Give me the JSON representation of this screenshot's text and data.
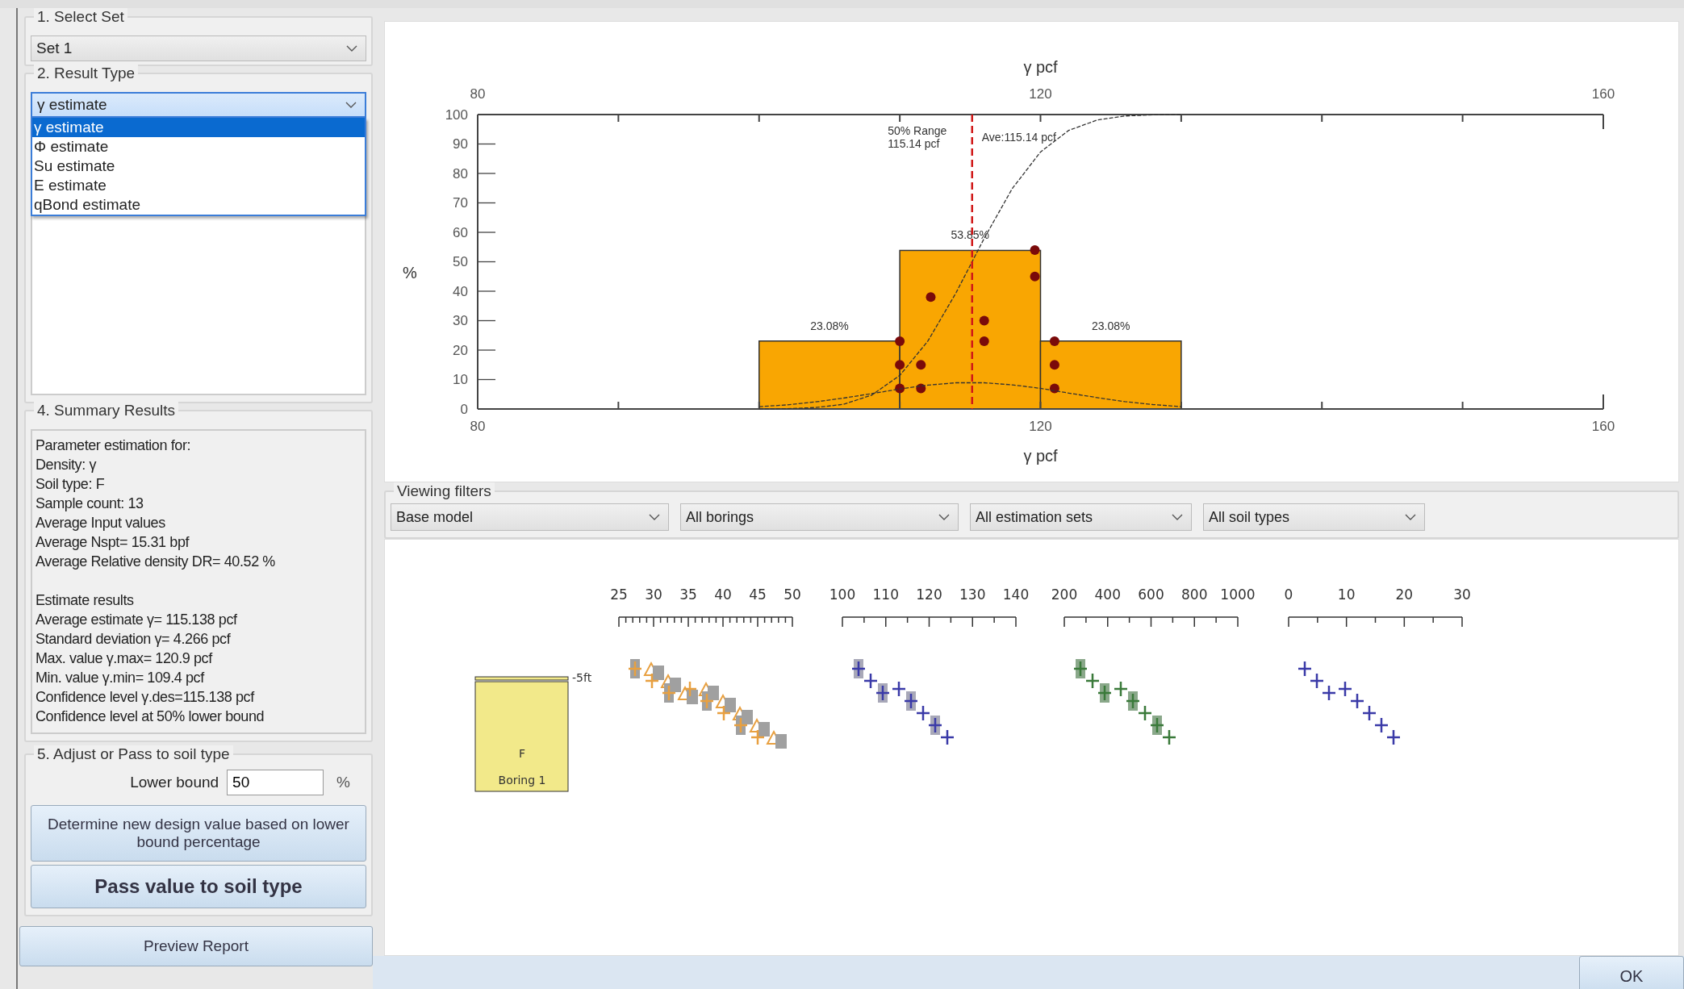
{
  "select_set": {
    "title": "1. Select Set",
    "value": "Set 1"
  },
  "result_type": {
    "title": "2. Result Type",
    "value": "γ estimate",
    "options": [
      {
        "label": "γ estimate",
        "selected": true
      },
      {
        "label": "Φ estimate",
        "selected": false
      },
      {
        "label": "Su estimate",
        "selected": false
      },
      {
        "label": "E estimate",
        "selected": false
      },
      {
        "label": "qBond estimate",
        "selected": false
      }
    ]
  },
  "summary": {
    "title": "4. Summary Results",
    "sections": [
      [
        "Parameter estimation for:",
        "Density: γ",
        "Soil type: F",
        "Sample count: 13",
        "Average Input values",
        "Average Nspt= 15.31 bpf",
        "Average Relative density DR= 40.52 %"
      ],
      [
        "Estimate results",
        "Average estimate γ= 115.138 pcf",
        "Standard deviation γ= 4.266 pcf",
        "Max. value γ.max= 120.9 pcf",
        "Min. value γ.min= 109.4 pcf",
        "Confidence level γ.des=115.138 pcf",
        "Confidence level at 50% lower bound"
      ]
    ]
  },
  "adjust": {
    "title": "5. Adjust or Pass to soil type",
    "lower_bound_label": "Lower bound",
    "lower_bound_value": "50",
    "unit": "%",
    "buttons": [
      {
        "label": "Determine new design value based on lower bound percentage",
        "kind": "normal"
      },
      {
        "label": "Pass value to soil type",
        "kind": "bold"
      }
    ]
  },
  "preview_button": "Preview Report",
  "chart": {
    "chart_data": {
      "type": "bar",
      "xlabel": "γ pcf",
      "ylabel": "%",
      "x": [
        105,
        115,
        125
      ],
      "series": [
        {
          "type": "bar",
          "color": "#f9a602",
          "values": [
            23.08,
            53.85,
            23.08
          ]
        },
        {
          "type": "scatter",
          "color": "#7a0a0a",
          "x": [
            110,
            110,
            110,
            111.5,
            111.5,
            112.2,
            116,
            116,
            119.6,
            119.6,
            121,
            121,
            121
          ],
          "values": [
            7,
            15,
            23,
            7,
            15,
            38,
            23,
            30,
            45,
            54,
            7,
            15,
            23
          ]
        },
        {
          "type": "line",
          "line_style": "dashed",
          "color": "#333333",
          "x": [
            100,
            102,
            104,
            106,
            108,
            110,
            112,
            114,
            116,
            118,
            120,
            122,
            124,
            126,
            128,
            130
          ],
          "values": [
            0,
            0.1,
            0.5,
            1.6,
            4.7,
            11.4,
            23.1,
            39.5,
            58,
            74.9,
            87.3,
            94.6,
            98.1,
            99.5,
            99.9,
            100
          ]
        },
        {
          "type": "line",
          "line_style": "dashed",
          "color": "#333333",
          "x": [
            100,
            102,
            104,
            106,
            108,
            110,
            112,
            114,
            116,
            118,
            120,
            122,
            124,
            126,
            128,
            130
          ],
          "values": [
            0.8,
            1.4,
            2.4,
            3.7,
            5.2,
            6.8,
            8.1,
            8.9,
            8.9,
            8.2,
            7,
            5.4,
            3.9,
            2.5,
            1.5,
            0.8
          ]
        }
      ],
      "xlim": [
        80,
        160
      ],
      "ylim": [
        0,
        100
      ],
      "xticks": [
        {
          "value": 80,
          "label": "80"
        },
        {
          "value": 120,
          "label": "120"
        },
        {
          "value": 160,
          "label": "160"
        }
      ],
      "yticks": [
        0,
        10,
        20,
        30,
        40,
        50,
        60,
        70,
        80,
        90,
        100
      ],
      "value_labels": [
        "23.08%",
        "53.85%",
        "23.08%"
      ],
      "ref_lines": [
        {
          "axis": "x",
          "value": 115.14,
          "color": "#d01818"
        }
      ],
      "annotations": [
        "50% Range",
        "115.14 pcf",
        "Ave:115.14 pcf"
      ]
    },
    "top_axis": {
      "label": "γ pcf",
      "ticks": [
        "80",
        "120",
        "160"
      ]
    }
  },
  "viewing_filters": {
    "title": "Viewing filters",
    "filters": [
      "Base model",
      "All borings",
      "All estimation sets",
      "All soil types"
    ]
  },
  "profile": {
    "scales": [
      {
        "kind": "fine",
        "ticks": [
          "25",
          "30",
          "35",
          "40",
          "45",
          "50"
        ]
      },
      {
        "kind": "coarse",
        "ticks": [
          "100",
          "110",
          "120",
          "130",
          "140"
        ]
      },
      {
        "kind": "coarse",
        "ticks": [
          "200",
          "400",
          "600",
          "800",
          "1000"
        ]
      },
      {
        "kind": "coarse",
        "ticks": [
          "0",
          "10",
          "20",
          "30"
        ]
      }
    ],
    "boring": {
      "depth": "-5ft",
      "soil": "F",
      "name": "Boring 1"
    }
  },
  "ok_button": "OK"
}
